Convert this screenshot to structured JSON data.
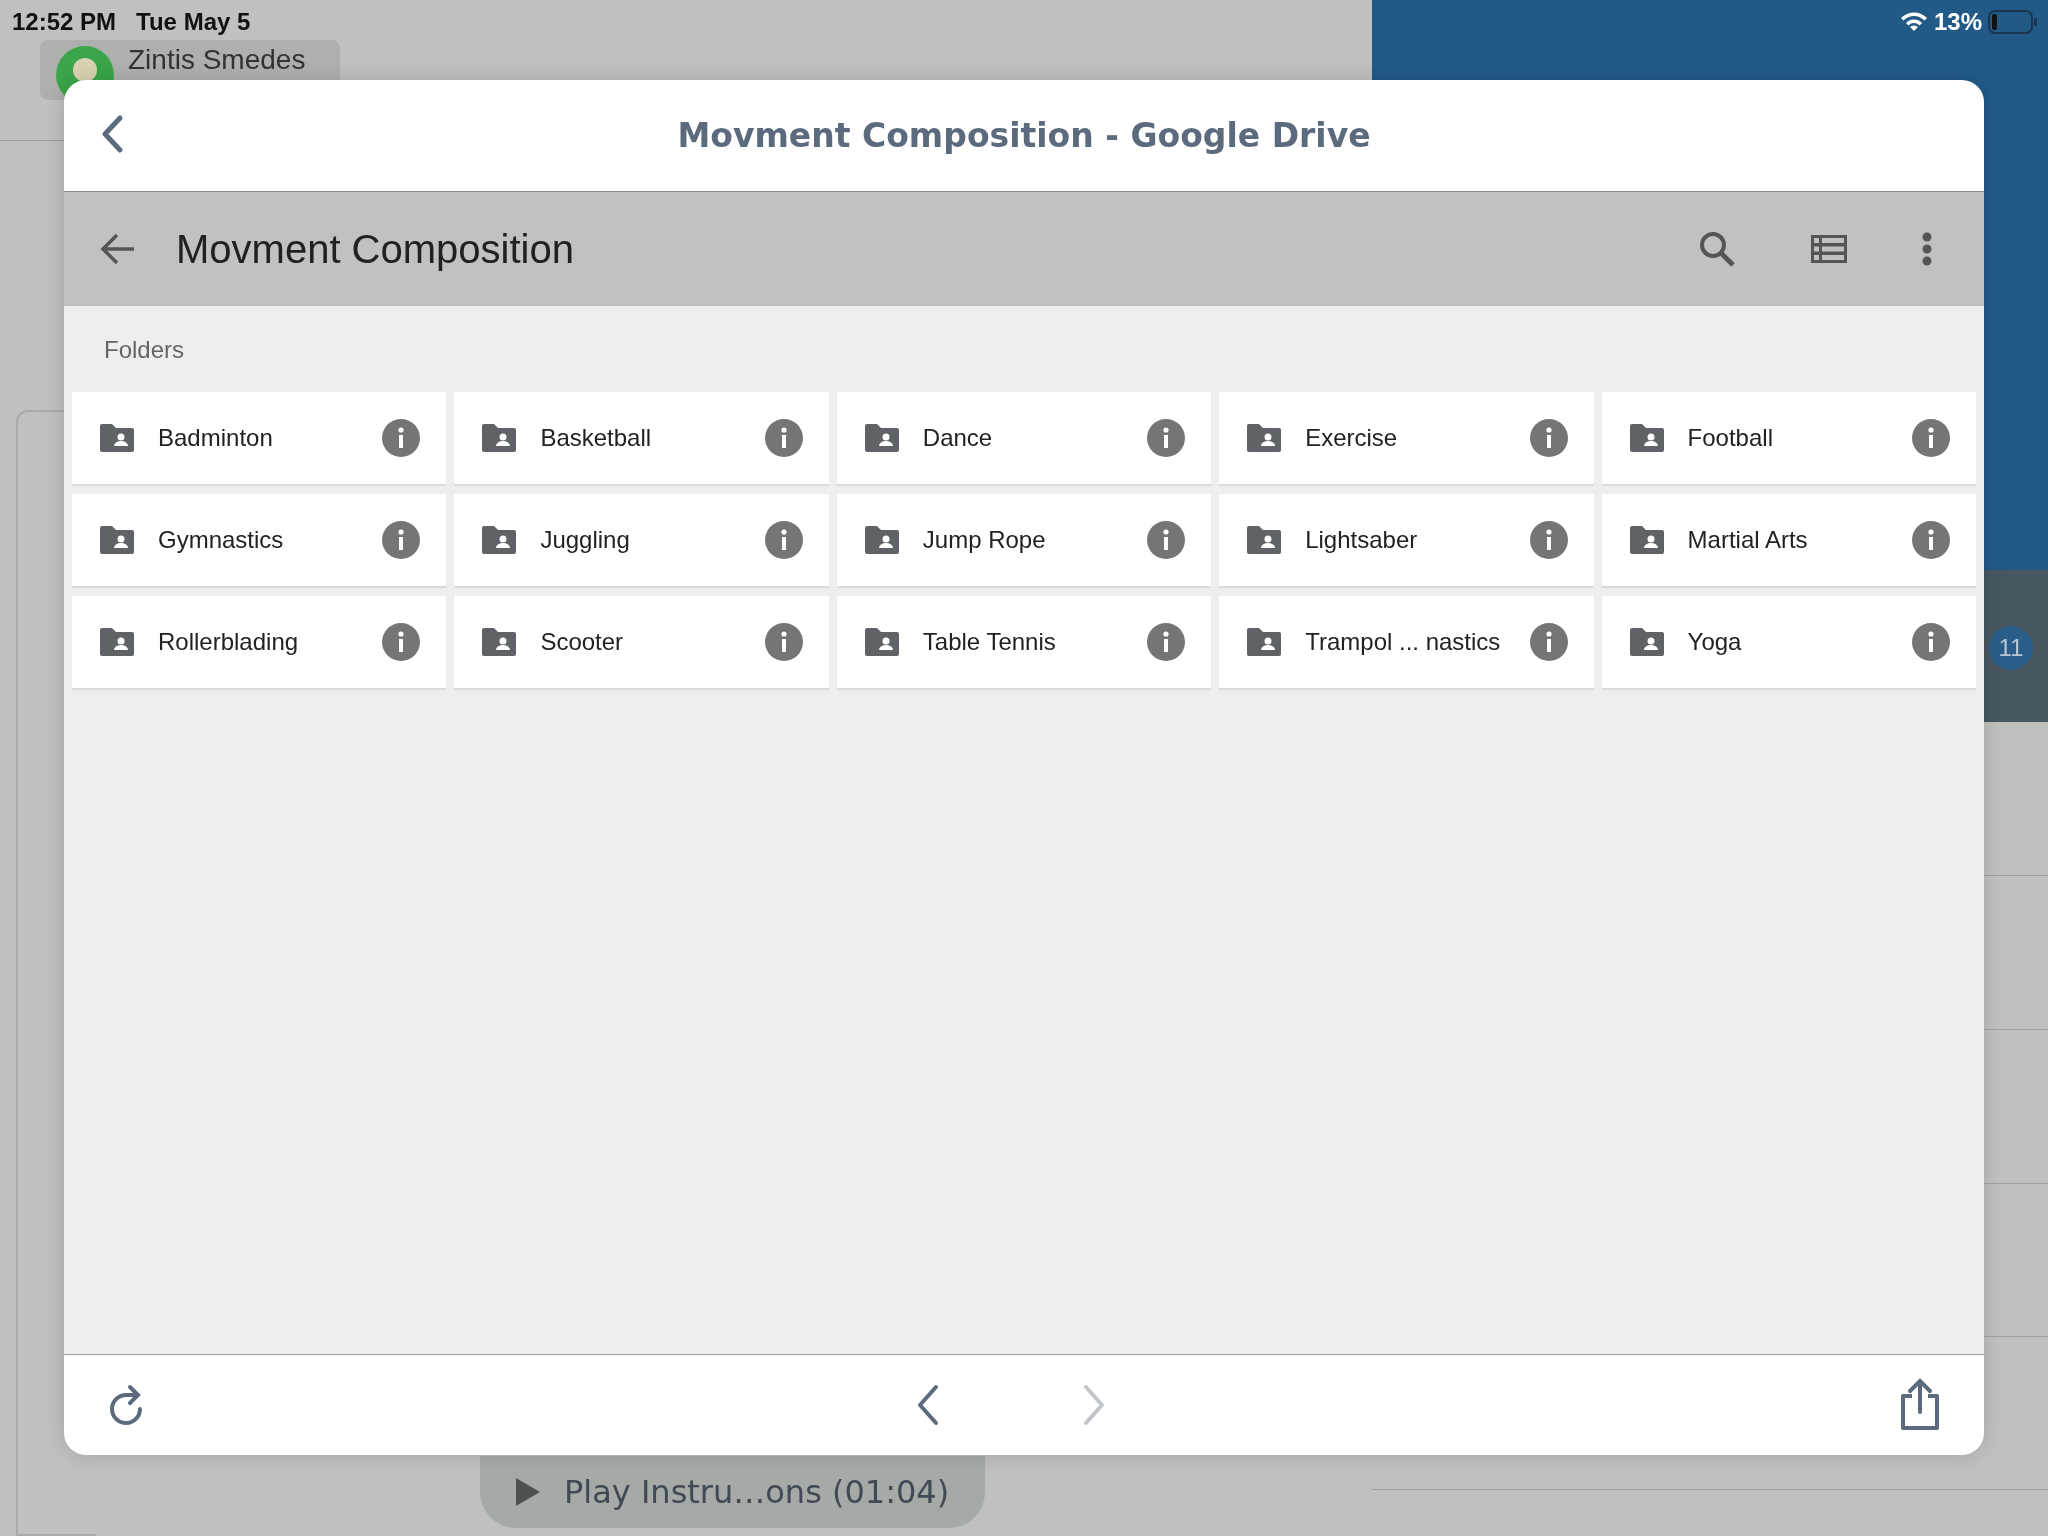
{
  "status_bar": {
    "time": "12:52 PM",
    "date": "Tue May 5",
    "battery": "13%"
  },
  "background": {
    "user_name": "Zintis Smedes",
    "badge": "11",
    "play_button": "Play Instru…ons (01:04)"
  },
  "dialog": {
    "title": "Movment Composition - Google Drive",
    "toolbar_title": "Movment Composition",
    "section_label": "Folders",
    "folders": [
      "Badminton",
      "Basketball",
      "Dance",
      "Exercise",
      "Football",
      "Gymnastics",
      "Juggling",
      "Jump Rope",
      "Lightsaber",
      "Martial Arts",
      "Rollerblading",
      "Scooter",
      "Table Tennis",
      "Trampol ... nastics",
      "Yoga"
    ],
    "nav": {
      "back_disabled": false,
      "forward_disabled": true
    }
  }
}
